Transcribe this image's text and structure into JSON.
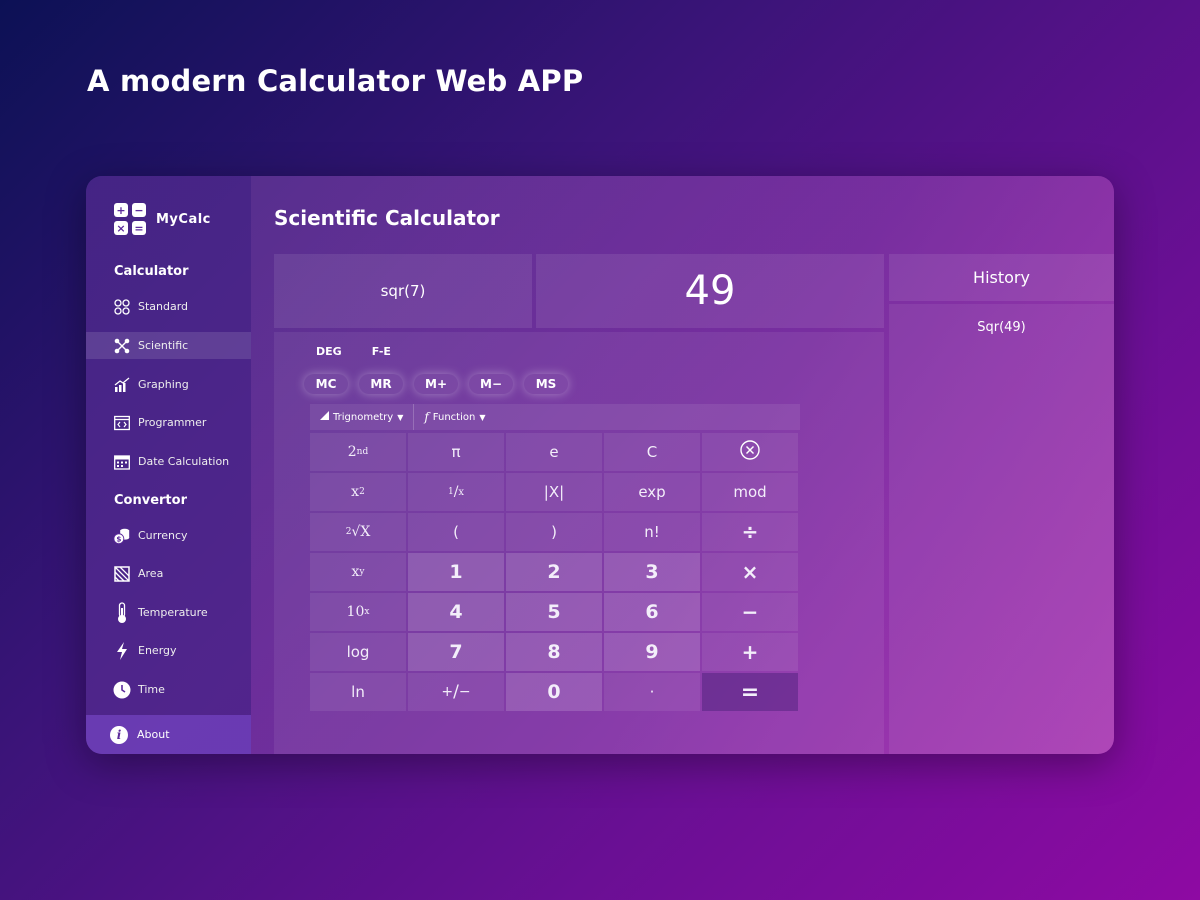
{
  "page": {
    "title": "A modern Calculator Web APP"
  },
  "brand": {
    "name": "MyCalc",
    "logo_symbols": [
      "+",
      "−",
      "×",
      "="
    ]
  },
  "sidebar": {
    "calculator_heading": "Calculator",
    "calculator_items": [
      {
        "label": "Standard",
        "icon": "standard-icon"
      },
      {
        "label": "Scientific",
        "icon": "scientific-icon",
        "active": true
      },
      {
        "label": "Graphing",
        "icon": "graphing-icon"
      },
      {
        "label": "Programmer",
        "icon": "programmer-icon"
      },
      {
        "label": "Date Calculation",
        "icon": "calendar-icon"
      }
    ],
    "convertor_heading": "Convertor",
    "convertor_items": [
      {
        "label": "Currency",
        "icon": "currency-icon"
      },
      {
        "label": "Area",
        "icon": "area-icon"
      },
      {
        "label": "Temperature",
        "icon": "thermometer-icon"
      },
      {
        "label": "Energy",
        "icon": "lightning-icon"
      },
      {
        "label": "Time",
        "icon": "clock-icon"
      }
    ],
    "about": {
      "label": "About",
      "icon": "info-icon"
    }
  },
  "main": {
    "title": "Scientific Calculator",
    "expression": "sqr(7)",
    "result": "49"
  },
  "pad": {
    "modes": [
      "DEG",
      "F-E"
    ],
    "memory": [
      "MC",
      "MR",
      "M+",
      "M−",
      "MS"
    ],
    "functions": [
      {
        "label": "Trignometry",
        "icon": "triangle-icon"
      },
      {
        "label": "Function",
        "icon": "function-icon"
      }
    ],
    "keys": {
      "r1": [
        "2nd",
        "π",
        "e",
        "C",
        "⊗"
      ],
      "r2": [
        "x2",
        "1/x",
        "|X|",
        "exp",
        "mod"
      ],
      "r3": [
        "2√X",
        "(",
        ")",
        "n!",
        "÷"
      ],
      "r4": [
        "xy",
        "1",
        "2",
        "3",
        "×"
      ],
      "r5": [
        "10x",
        "4",
        "5",
        "6",
        "−"
      ],
      "r6": [
        "log",
        "7",
        "8",
        "9",
        "+"
      ],
      "r7": [
        "ln",
        "+/−",
        "0",
        "·",
        "="
      ]
    }
  },
  "history": {
    "title": "History",
    "items": [
      "Sqr(49)"
    ]
  },
  "colors": {
    "background_start": "#0c1155",
    "background_end": "#8e0aa3",
    "about_bg": "#7a46c8"
  }
}
